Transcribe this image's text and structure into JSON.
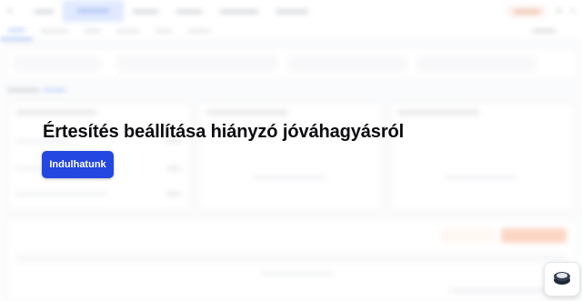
{
  "overlay": {
    "title": "Értesítés beállítása hiányzó jóváhagyásról",
    "start_button_label": "Indulhatunk"
  },
  "colors": {
    "primary_button": "#2347e0",
    "active_nav": "#c7d8ff",
    "accent_orange": "#fbb493"
  },
  "icons": {
    "help_widget": "support-widget-icon"
  }
}
